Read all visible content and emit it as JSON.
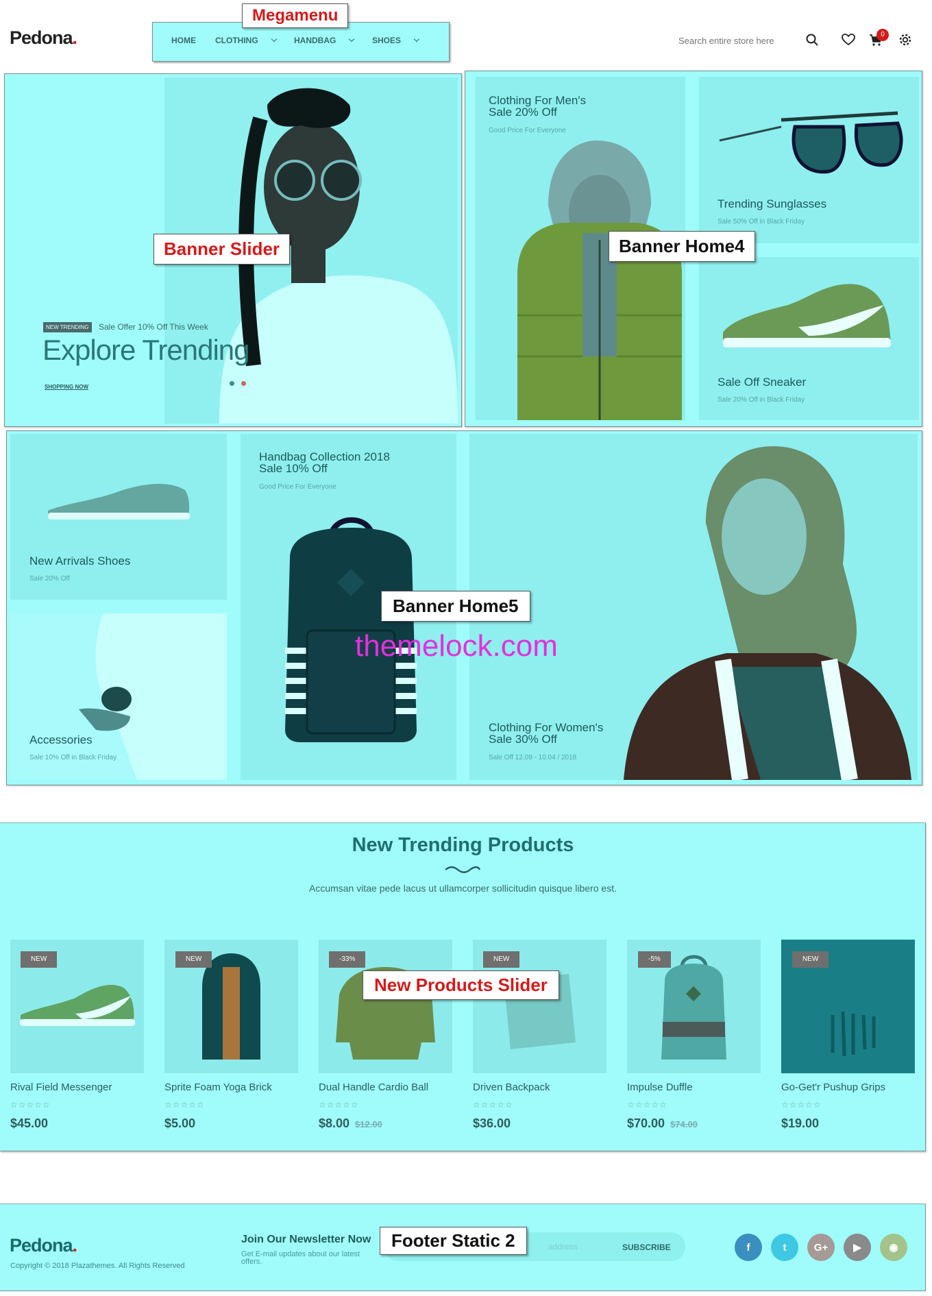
{
  "header": {
    "logo": "Pedona",
    "logo_dot": ".",
    "nav": [
      {
        "label": "HOME"
      },
      {
        "label": "CLOTHING"
      },
      {
        "label": "HANDBAG"
      },
      {
        "label": "SHOES"
      }
    ],
    "search_placeholder": "Search entire store here",
    "cart_count": "0"
  },
  "callouts": {
    "megamenu": "Megamenu",
    "banner_slider": "Banner Slider",
    "banner_home4": "Banner Home4",
    "banner_home5": "Banner Home5",
    "new_products_slider": "New Products Slider",
    "footer_static": "Footer Static 2"
  },
  "slider": {
    "badge": "NEW TRENDING",
    "offer": "Sale Offer 10% Off This Week",
    "headline": "Explore Trending",
    "cta": "SHOPPING NOW"
  },
  "home4": {
    "men": {
      "title1": "Clothing For Men's",
      "title2": "Sale 20% Off",
      "sub": "Good Price For Everyone"
    },
    "sunglasses": {
      "title": "Trending Sunglasses",
      "sub": "Sale 50% Off in Black Friday"
    },
    "sneaker": {
      "title": "Sale Off Sneaker",
      "sub": "Sale 20% Off in Black Friday"
    }
  },
  "home5": {
    "shoes": {
      "title": "New Arrivals Shoes",
      "sub": "Sale 20% Off"
    },
    "accessories": {
      "title": "Accessories",
      "sub": "Sale 10% Off in Black Friday"
    },
    "handbag": {
      "title1": "Handbag Collection 2018",
      "title2": "Sale 10% Off",
      "sub": "Good Price For Everyone"
    },
    "women": {
      "title1": "Clothing For Women's",
      "title2": "Sale 30% Off",
      "sub": "Sale Off 12.09 - 10.04 / 2018"
    }
  },
  "watermark": "themelock.com",
  "trending": {
    "title": "New Trending Products",
    "subtitle": "Accumsan vitae pede lacus ut ullamcorper sollicitudin quisque libero est.",
    "products": [
      {
        "badge": "NEW",
        "name": "Rival Field Messenger",
        "price": "$45.00",
        "old_price": ""
      },
      {
        "badge": "NEW",
        "name": "Sprite Foam Yoga Brick",
        "price": "$5.00",
        "old_price": ""
      },
      {
        "badge": "-33%",
        "name": "Dual Handle Cardio Ball",
        "price": "$8.00",
        "old_price": "$12.00"
      },
      {
        "badge": "NEW",
        "name": "Driven Backpack",
        "price": "$36.00",
        "old_price": ""
      },
      {
        "badge": "-5%",
        "name": "Impulse Duffle",
        "price": "$70.00",
        "old_price": "$74.00"
      },
      {
        "badge": "NEW",
        "name": "Go-Get'r Pushup Grips",
        "price": "$19.00",
        "old_price": ""
      }
    ]
  },
  "footer": {
    "logo": "Pedona",
    "logo_dot": ".",
    "copyright": "Copyright © 2018 Plazathemes. All Rights Reserved",
    "newsletter_title": "Join Our Newsletter Now",
    "newsletter_desc": "Get E-mail updates about our latest",
    "newsletter_desc2": "offers.",
    "email_placeholder": "address",
    "subscribe": "SUBSCRIBE",
    "social": [
      {
        "icon": "facebook-icon",
        "glyph": "f",
        "color": "#3b8fc0"
      },
      {
        "icon": "twitter-icon",
        "glyph": "t",
        "color": "#3ec8e3"
      },
      {
        "icon": "google-plus-icon",
        "glyph": "G+",
        "color": "#a59a96"
      },
      {
        "icon": "youtube-icon",
        "glyph": "▶",
        "color": "#8a8a8a"
      },
      {
        "icon": "rss-icon",
        "glyph": "◉",
        "color": "#a3c38a"
      }
    ]
  }
}
